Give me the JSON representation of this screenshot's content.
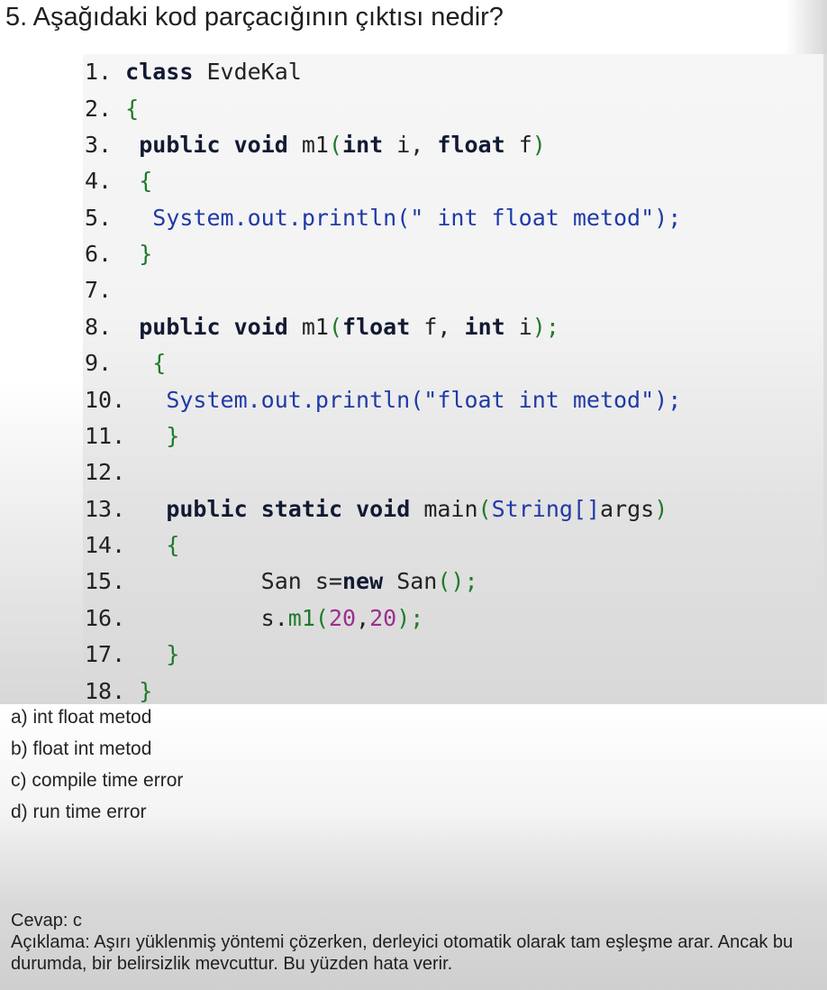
{
  "question": {
    "title": "5. Aşağıdaki kod parçacığının çıktısı nedir?"
  },
  "code": {
    "lines": [
      [
        {
          "t": "1. ",
          "c": "pl"
        },
        {
          "t": "class",
          "c": "kw"
        },
        {
          "t": " EvdeKal",
          "c": "pl"
        }
      ],
      [
        {
          "t": "2. ",
          "c": "pl"
        },
        {
          "t": "{",
          "c": "gr"
        }
      ],
      [
        {
          "t": "3.  ",
          "c": "pl"
        },
        {
          "t": "public",
          "c": "kw"
        },
        {
          "t": " ",
          "c": "pl"
        },
        {
          "t": "void",
          "c": "kw"
        },
        {
          "t": " m1",
          "c": "pl"
        },
        {
          "t": "(",
          "c": "gr"
        },
        {
          "t": "int",
          "c": "kw"
        },
        {
          "t": " i, ",
          "c": "pl"
        },
        {
          "t": "float",
          "c": "kw"
        },
        {
          "t": " f",
          "c": "pl"
        },
        {
          "t": ")",
          "c": "gr"
        }
      ],
      [
        {
          "t": "4.  ",
          "c": "pl"
        },
        {
          "t": "{",
          "c": "gr"
        }
      ],
      [
        {
          "t": "5.   ",
          "c": "pl"
        },
        {
          "t": "System.out.println(\" int float metod\");",
          "c": "str"
        }
      ],
      [
        {
          "t": "6.  ",
          "c": "pl"
        },
        {
          "t": "}",
          "c": "gr"
        }
      ],
      [
        {
          "t": "7.",
          "c": "pl"
        }
      ],
      [
        {
          "t": "8.  ",
          "c": "pl"
        },
        {
          "t": "public",
          "c": "kw"
        },
        {
          "t": " ",
          "c": "pl"
        },
        {
          "t": "void",
          "c": "kw"
        },
        {
          "t": " m1",
          "c": "pl"
        },
        {
          "t": "(",
          "c": "gr"
        },
        {
          "t": "float",
          "c": "kw"
        },
        {
          "t": " f, ",
          "c": "pl"
        },
        {
          "t": "int",
          "c": "kw"
        },
        {
          "t": " i",
          "c": "pl"
        },
        {
          "t": ");",
          "c": "gr"
        }
      ],
      [
        {
          "t": "9.   ",
          "c": "pl"
        },
        {
          "t": "{",
          "c": "gr"
        }
      ],
      [
        {
          "t": "10.   ",
          "c": "pl"
        },
        {
          "t": "System.out.println(\"float int metod\");",
          "c": "str"
        }
      ],
      [
        {
          "t": "11.   ",
          "c": "pl"
        },
        {
          "t": "}",
          "c": "gr"
        }
      ],
      [
        {
          "t": "12.",
          "c": "pl"
        }
      ],
      [
        {
          "t": "13.   ",
          "c": "pl"
        },
        {
          "t": "public",
          "c": "kw"
        },
        {
          "t": " ",
          "c": "pl"
        },
        {
          "t": "static",
          "c": "kw"
        },
        {
          "t": " ",
          "c": "pl"
        },
        {
          "t": "void",
          "c": "kw"
        },
        {
          "t": " main",
          "c": "pl"
        },
        {
          "t": "(",
          "c": "gr"
        },
        {
          "t": "String[]",
          "c": "str"
        },
        {
          "t": "args",
          "c": "pl"
        },
        {
          "t": ")",
          "c": "gr"
        }
      ],
      [
        {
          "t": "14.   ",
          "c": "pl"
        },
        {
          "t": "{",
          "c": "gr"
        }
      ],
      [
        {
          "t": "15.          ",
          "c": "pl"
        },
        {
          "t": "San s=",
          "c": "pl"
        },
        {
          "t": "new",
          "c": "kw"
        },
        {
          "t": " San",
          "c": "pl"
        },
        {
          "t": "();",
          "c": "gr"
        }
      ],
      [
        {
          "t": "16.          ",
          "c": "pl"
        },
        {
          "t": "s.",
          "c": "pl"
        },
        {
          "t": "m1",
          "c": "gr"
        },
        {
          "t": "(",
          "c": "gr"
        },
        {
          "t": "20",
          "c": "num"
        },
        {
          "t": ",",
          "c": "pl"
        },
        {
          "t": "20",
          "c": "num"
        },
        {
          "t": ");",
          "c": "gr"
        }
      ],
      [
        {
          "t": "17.   ",
          "c": "pl"
        },
        {
          "t": "}",
          "c": "gr"
        }
      ],
      [
        {
          "t": "18. ",
          "c": "pl"
        },
        {
          "t": "}",
          "c": "gr"
        }
      ]
    ]
  },
  "options": [
    "a) int float metod",
    "b) float int metod",
    "c) compile time error",
    "d) run time error"
  ],
  "answer": {
    "label": "Cevap: c",
    "explanation": "Açıklama: Aşırı yüklenmiş yöntemi çözerken, derleyici otomatik olarak tam eşleşme arar. Ancak bu durumda, bir belirsizlik mevcuttur. Bu yüzden hata verir."
  },
  "colors": {
    "keyword": "#121a33",
    "plain": "#222222",
    "string": "#1f3aa6",
    "green": "#207a2a",
    "number": "#9b2f91"
  }
}
